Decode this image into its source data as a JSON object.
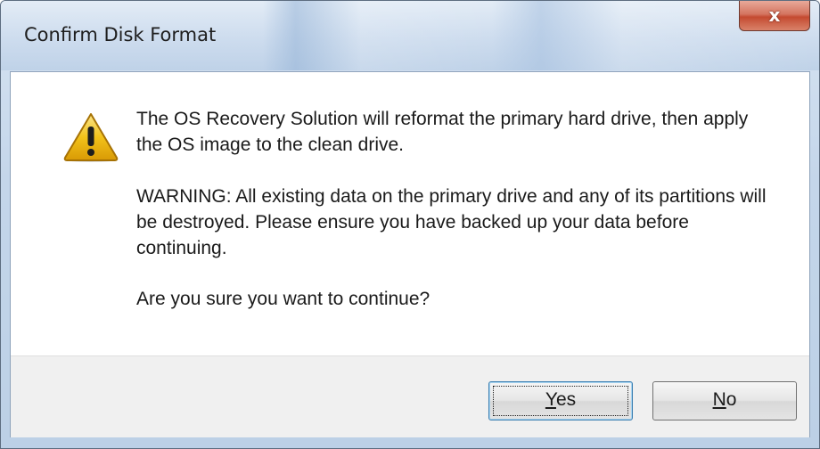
{
  "window": {
    "title": "Confirm Disk Format",
    "close_glyph": "x"
  },
  "dialog": {
    "icon": "warning-icon",
    "message_1": "The OS Recovery Solution will reformat the primary hard drive, then apply the OS image to the clean drive.",
    "message_2": "WARNING: All existing data on the primary drive and any of its partitions will be destroyed. Please ensure you have backed up your data before continuing.",
    "message_3": "Are you sure you want to continue?"
  },
  "buttons": {
    "yes_label": "Yes",
    "no_label": "No"
  },
  "colors": {
    "close_button": "#c44a30",
    "warning_icon": "#f2c21a",
    "footer": "#f0f0f0"
  }
}
